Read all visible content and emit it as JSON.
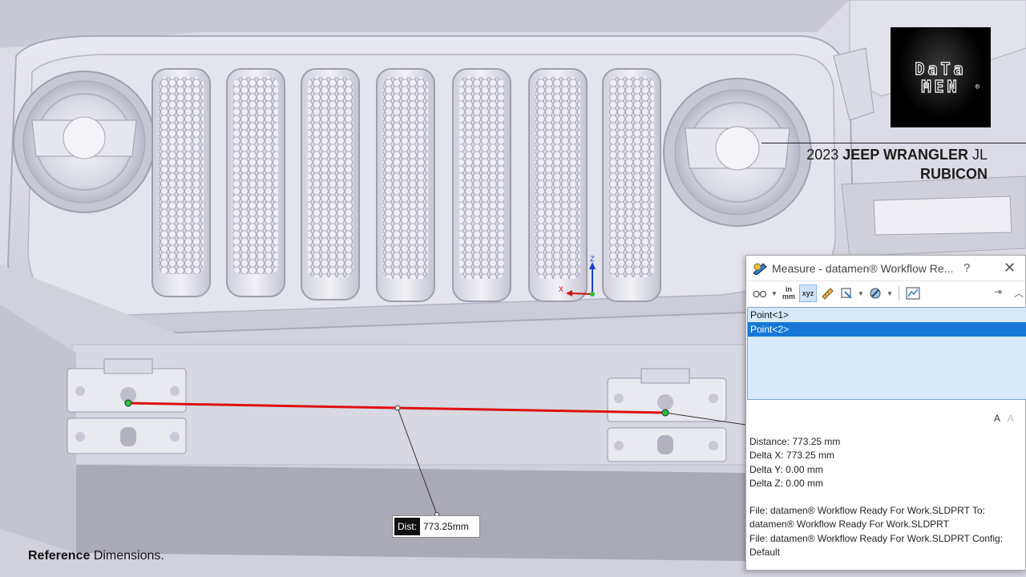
{
  "logo": {
    "line1": "DaTa",
    "line2": "MEN",
    "reg": "®"
  },
  "vehicle": {
    "year": "2023",
    "make_model": "JEEP WRANGLER",
    "trim_suffix": "JL",
    "line2": "RUBICON"
  },
  "caption": {
    "bold": "Reference",
    "rest": " Dimensions."
  },
  "callout": {
    "key": "Dist:",
    "value": "773.25mm"
  },
  "triad": {
    "z": "Z",
    "x": "X"
  },
  "measure_panel": {
    "title": "Measure - datamen® Workflow Re...",
    "help": "?",
    "close": "✕",
    "toolbar": {
      "icons": [
        "arc-circle-icon",
        "units-icon",
        "xyz-icon",
        "point-to-point-icon",
        "projection-icon",
        "sensor-icon",
        "history-icon"
      ],
      "units_in": "in",
      "units_mm": "mm",
      "xyz": "xyz",
      "pin": "⇥",
      "collapse": "︿"
    },
    "selections": [
      "Point<1>",
      "Point<2>"
    ],
    "selected_index": 1,
    "font_buttons": {
      "increase": "A",
      "decrease": "A"
    },
    "results": {
      "distance": "Distance: 773.25 mm",
      "dx": "Delta X: 773.25 mm",
      "dy": "Delta Y: 0.00 mm",
      "dz": "Delta Z: 0.00 mm",
      "file_line1": "File: datamen® Workflow Ready For Work.SLDPRT To:",
      "file_line2": "datamen® Workflow Ready For Work.SLDPRT",
      "file_line3": "File: datamen® Workflow Ready For Work.SLDPRT Config:",
      "file_line4": "Default"
    }
  },
  "colors": {
    "measure_line": "#e01010",
    "point": "#2fbf2f",
    "selection": "#1578d8",
    "list_bg": "#d6eafc"
  }
}
